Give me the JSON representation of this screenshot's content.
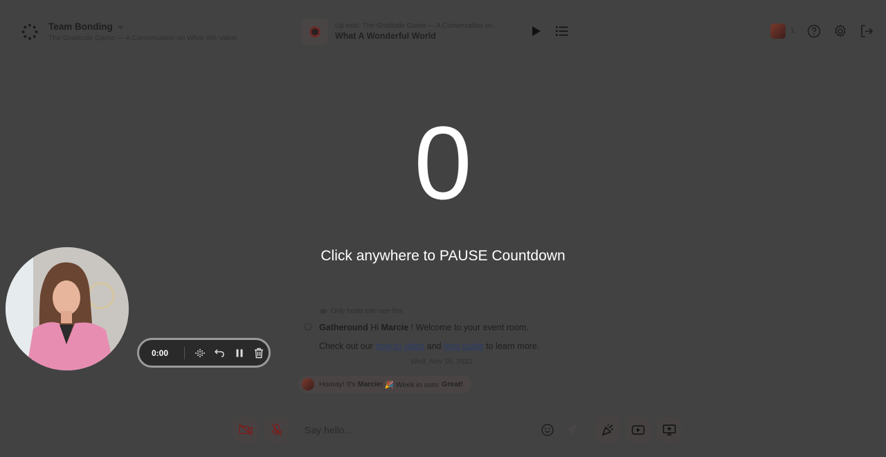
{
  "room": {
    "title": "Team Bonding",
    "subtitle": "The Gratitude Game — A Conversation on What We Value"
  },
  "music": {
    "up_next_label": "Up next: The Gratitude Game — A Conversation on ...",
    "track": "What A Wonderful World"
  },
  "header": {
    "participant_count": "1"
  },
  "countdown": {
    "value": "0",
    "message": "Click anywhere to PAUSE Countdown"
  },
  "chat": {
    "visibility_note": "Only hosts can see this",
    "sender": "Gatheround",
    "greeting_pre": " Hi ",
    "user_name": "Marcie",
    "greeting_post": " ! Welcome to your event room.",
    "line2_pre": "Check out our ",
    "link_video": "how-to video",
    "line2_mid": " and ",
    "link_guide": "host guide",
    "line2_post": " to learn more.",
    "date": "Wed, Nov 16, 2022",
    "hooray_pre": "Hooray! It's ",
    "hooray_name": "Marcie",
    "hooray_mid": " ! 🎉  Week in sum: ",
    "hooray_result": "Great!"
  },
  "recorder": {
    "time": "0:00"
  },
  "composer": {
    "placeholder": "Say hello..."
  }
}
